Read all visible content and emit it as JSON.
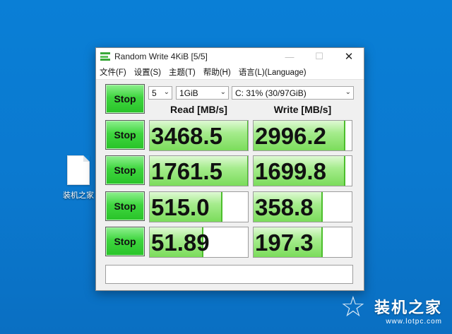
{
  "desktop": {
    "icon_label": "装机之家"
  },
  "window": {
    "title": "Random Write 4KiB [5/5]",
    "controls": {
      "minimize": "—",
      "maximize": "☐",
      "close": "✕"
    }
  },
  "menu": [
    "文件(F)",
    "设置(S)",
    "主题(T)",
    "帮助(H)",
    "语言(L)(Language)"
  ],
  "settings": {
    "count": "5",
    "size": "1GiB",
    "drive": "C: 31% (30/97GiB)"
  },
  "buttons": {
    "stop_label": "Stop"
  },
  "headers": {
    "read": "Read [MB/s]",
    "write": "Write [MB/s]"
  },
  "results": [
    {
      "read": "3468.5",
      "write": "2996.2",
      "read_fill": 0.99,
      "write_fill": 0.92
    },
    {
      "read": "1761.5",
      "write": "1699.8",
      "read_fill": 0.99,
      "write_fill": 0.92
    },
    {
      "read": "515.0",
      "write": "358.8",
      "read_fill": 0.73,
      "write_fill": 0.69
    },
    {
      "read": "51.89",
      "write": "197.3",
      "read_fill": 0.53,
      "write_fill": 0.69
    }
  ],
  "comment": "",
  "watermark": {
    "name": "装机之家",
    "url": "www.lotpc.com"
  },
  "colors": {
    "desktop": "#0a7fd6",
    "stop_green": "#3fd63f",
    "bar_green": "#7bdc5b"
  }
}
